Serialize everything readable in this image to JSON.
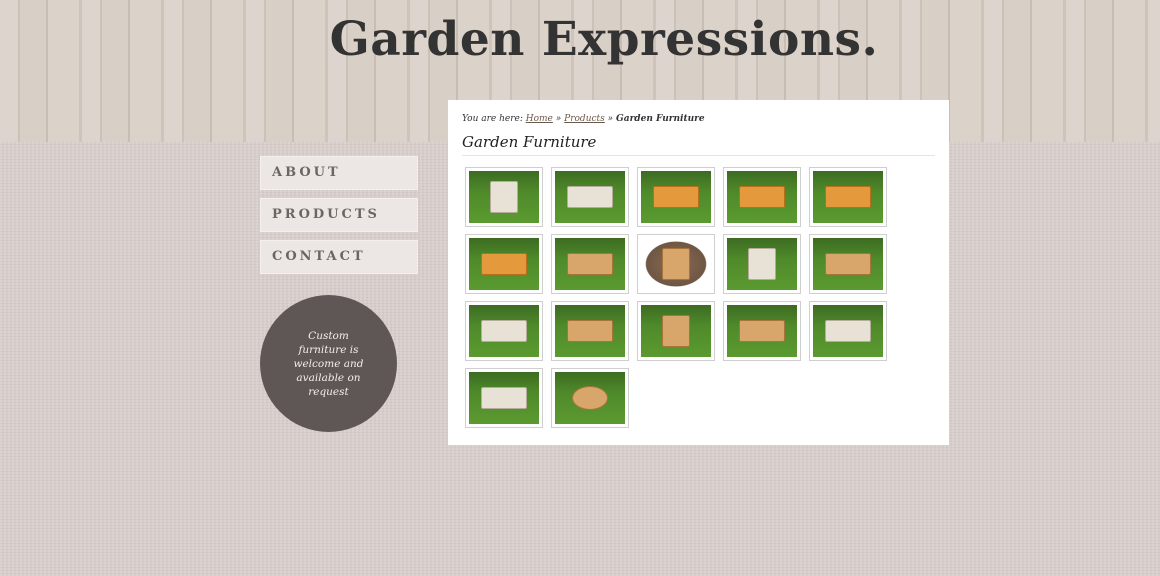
{
  "header": {
    "site_title": "Garden Expressions."
  },
  "nav": {
    "items": [
      {
        "label": "ABOUT"
      },
      {
        "label": "PRODUCTS"
      },
      {
        "label": "CONTACT"
      }
    ]
  },
  "promo": {
    "text": "Custom furniture is welcome and available on request"
  },
  "breadcrumb": {
    "prefix": "You are here:",
    "home": "Home",
    "separator1": "»",
    "products": "Products",
    "separator2": "»",
    "current": "Garden Furniture"
  },
  "page": {
    "heading": "Garden Furniture"
  },
  "gallery": {
    "thumbnails": [
      "porch-swing",
      "white-picnic-table",
      "picnic-table",
      "octagon-picnic-table",
      "octagon-picnic-table",
      "octagon-picnic-table",
      "potting-bench",
      "adirondack-chair",
      "white-adirondack-chair",
      "adirondack-chair-set",
      "loveseat-bench",
      "adirondack-chair-pair",
      "adirondack-chair",
      "table-with-benches",
      "white-table-with-benches",
      "folding-table",
      "round-table"
    ],
    "colors": {
      "grass": "#4f8a2a",
      "wood": "#d8a56a"
    }
  }
}
